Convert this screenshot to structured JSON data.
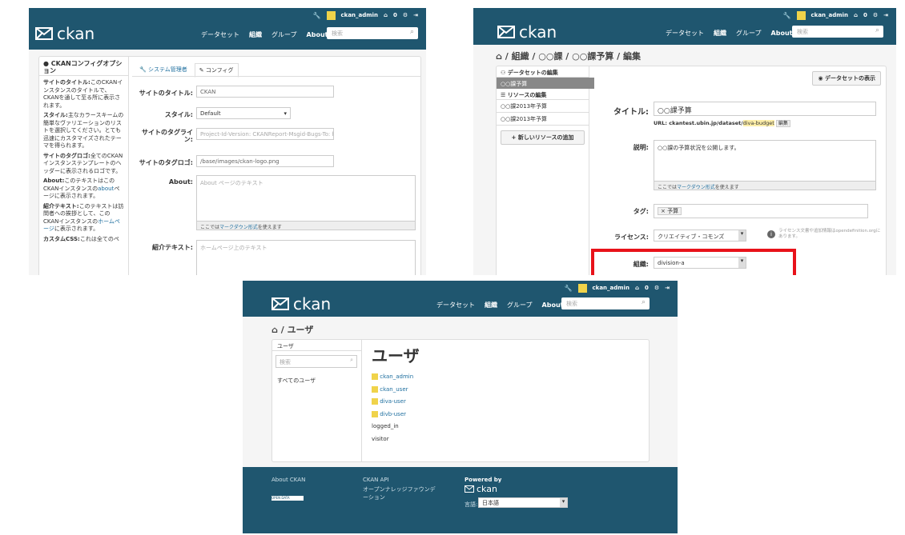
{
  "header": {
    "username": "ckan_admin",
    "dashboard_count": "0",
    "brand": "ckan",
    "nav": [
      "データセット",
      "組織",
      "グループ",
      "About"
    ],
    "search_placeholder": "検索"
  },
  "s1": {
    "sidebar_title": "CKANコンフィグオプション",
    "help": [
      {
        "term": "サイトのタイトル:",
        "text": "このCKANインスタンスのタイトルで、CKANを通して至る所に表示されます。"
      },
      {
        "term": "スタイル:",
        "text": "主なカラースキームの簡単なヴァリエーションのリストを選択してください。とても迅速にカスタマイズされたテーマを得られます。"
      },
      {
        "term": "サイトのタグロゴ:",
        "text": "全てのCKANインスタンステンプレートのヘッダーに表示されるロゴです。"
      },
      {
        "term": "About:",
        "text": "このテキストはこのCKANインスタンスの",
        "link": "about",
        "tail": "ページに表示されます。"
      },
      {
        "term": "紹介テキスト:",
        "text": "このテキストは訪問者への挨拶として、このCKANインスタンスの",
        "link": "ホームページ",
        "tail": "に表示されます。"
      },
      {
        "term": "カスタムCSS:",
        "text": "これは全てのペ"
      }
    ],
    "tabs": [
      "システム管理者",
      "コンフィグ"
    ],
    "labels": {
      "title": "サイトのタイトル:",
      "style": "スタイル:",
      "tagline": "サイトのタグライン:",
      "logo": "サイトのタグロゴ:",
      "about": "About:",
      "intro": "紹介テキスト:"
    },
    "values": {
      "title": "CKAN",
      "style": "Default",
      "tagline": "Project-Id-Version: CKANReport-Msgid-Bugs-To: h",
      "logo": "/base/images/ckan-logo.png"
    },
    "placeholders": {
      "about": "About ページのテキスト",
      "intro": "ホームページ上のテキスト"
    },
    "markdown_prefix": "ここでは",
    "markdown_link": "マークダウン形式",
    "markdown_suffix": "を使えます"
  },
  "s2": {
    "breadcrumb": [
      "組織",
      "○○課",
      "○○課予算",
      "編集"
    ],
    "sidebar": {
      "dataset_edit": "データセットの編集",
      "active_item": "○○課予算",
      "resources_edit": "リソースの編集",
      "resources": [
        "○○課2013年予算",
        "○○課2013年予算"
      ],
      "add_resource": "新しいリソースの追加"
    },
    "view_dataset": "データセットの表示",
    "labels": {
      "title": "タイトル:",
      "description": "説明:",
      "tags": "タグ:",
      "license": "ライセンス:",
      "org": "組織:"
    },
    "values": {
      "title": "○○課予算",
      "url_prefix": "URL: ckantest.ubin.jp/dataset/",
      "url_slug": "diva-budget",
      "url_edit": "編集",
      "description": "○○課の予算状況を公開します。",
      "tag": "予算",
      "license": "クリエイティブ・コモンズ",
      "license_note": "ライセンス文書や追加情報はopendefinition.orgにあります。",
      "org": "division-a"
    },
    "markdown_prefix": "ここでは",
    "markdown_link": "マークダウン形式",
    "markdown_suffix": "を使えます",
    "highlight_color": "#e8121a"
  },
  "s3": {
    "breadcrumb": "ユーザ",
    "sidebar_title": "ユーザ",
    "sidebar_search": "検索",
    "all_users": "すべてのユーザ",
    "heading": "ユーザ",
    "users": [
      "ckan_admin",
      "ckan_user",
      "diva-user",
      "divb-user"
    ],
    "plain_users": [
      "logged_in",
      "visitor"
    ],
    "footer": {
      "about": "About CKAN",
      "api": "CKAN API",
      "okfn": "オープンナレッジファウンデーション",
      "powered_by": "Powered by",
      "lang_label": "言語:",
      "lang_value": "日本語",
      "badge": "OPEN DATA"
    }
  },
  "colors": {
    "masthead": "#1f566f",
    "footer": "#1f566f",
    "accent": "#1f6f9f"
  }
}
